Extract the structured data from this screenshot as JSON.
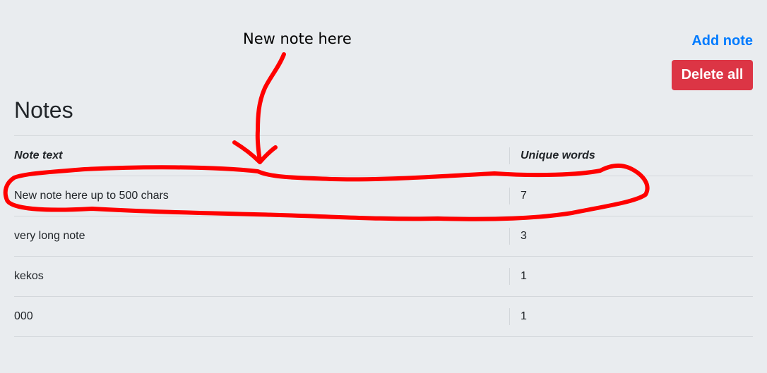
{
  "annotation": {
    "label": "New note here",
    "color": "#ff0000"
  },
  "header": {
    "add_note_label": "Add note",
    "delete_all_label": "Delete all"
  },
  "main": {
    "title": "Notes",
    "columns": [
      "Note text",
      "Unique words"
    ],
    "rows": [
      {
        "text": "New note here up to 500 chars",
        "unique_words": "7"
      },
      {
        "text": "very long note",
        "unique_words": "3"
      },
      {
        "text": "kekos",
        "unique_words": "1"
      },
      {
        "text": "000",
        "unique_words": "1"
      }
    ]
  },
  "colors": {
    "background": "#e9ecef",
    "link": "#007bff",
    "danger": "#dc3545"
  }
}
